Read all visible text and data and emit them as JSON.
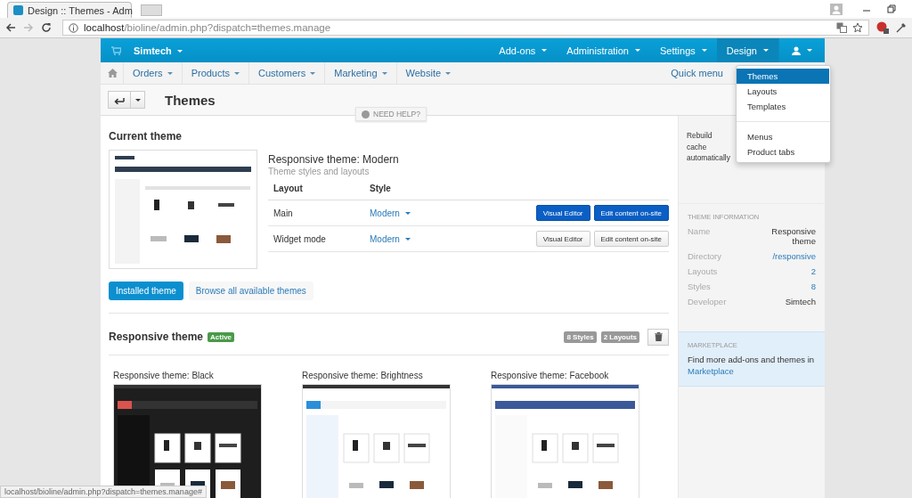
{
  "browser": {
    "tab_title": "Design :: Themes - Adm",
    "url_host": "localhost",
    "url_path": "/bioline/admin.php?dispatch=themes.manage",
    "status_url": "localhost/bioline/admin.php?dispatch=themes.manage#"
  },
  "topbar": {
    "brand": "Simtech",
    "menus": [
      {
        "label": "Add-ons",
        "selected": false
      },
      {
        "label": "Administration",
        "selected": false
      },
      {
        "label": "Settings",
        "selected": false
      },
      {
        "label": "Design",
        "selected": true
      }
    ]
  },
  "subnav": {
    "items": [
      "Orders",
      "Products",
      "Customers",
      "Marketing",
      "Website"
    ],
    "quick_menu": "Quick menu"
  },
  "dropdown": {
    "groups": [
      [
        {
          "label": "Themes",
          "selected": true
        },
        {
          "label": "Layouts",
          "selected": false
        },
        {
          "label": "Templates",
          "selected": false
        }
      ],
      [
        {
          "label": "Menus",
          "selected": false
        },
        {
          "label": "Product tabs",
          "selected": false
        }
      ]
    ]
  },
  "page": {
    "title": "Themes",
    "need_help": "NEED HELP?"
  },
  "current_theme": {
    "heading": "Current theme",
    "name": "Responsive theme: Modern",
    "subtitle": "Theme styles and layouts",
    "columns": [
      "Layout",
      "Style"
    ],
    "rows": [
      {
        "layout": "Main",
        "style": "Modern",
        "primary": true,
        "buttons": [
          "Visual Editor",
          "Edit content on-site"
        ]
      },
      {
        "layout": "Widget mode",
        "style": "Modern",
        "primary": false,
        "buttons": [
          "Visual Editor",
          "Edit content on-site"
        ]
      }
    ],
    "tabs": [
      {
        "label": "Installed theme",
        "selected": true
      },
      {
        "label": "Browse all available themes",
        "selected": false
      }
    ]
  },
  "theme_section": {
    "title": "Responsive theme",
    "badge": "Active",
    "counts": [
      "8 Styles",
      "2 Layouts"
    ],
    "styles": [
      {
        "name": "Responsive theme: Black",
        "kind": "picture"
      },
      {
        "name": "Responsive theme: Brightness",
        "kind": "picture"
      },
      {
        "name": "Responsive theme: Facebook",
        "kind": "picture"
      }
    ]
  },
  "sidebar": {
    "rebuild": "Rebuild cache automatically",
    "info_heading": "THEME INFORMATION",
    "info": [
      {
        "label": "Name",
        "value": "Responsive theme",
        "link": false
      },
      {
        "label": "Directory",
        "value": "/responsive",
        "link": true
      },
      {
        "label": "Layouts",
        "value": "2",
        "link": true
      },
      {
        "label": "Styles",
        "value": "8",
        "link": true
      },
      {
        "label": "Developer",
        "value": "Simtech",
        "link": false
      }
    ],
    "marketplace_heading": "MARKETPLACE",
    "marketplace_text": "Find more add-ons and themes in",
    "marketplace_link": "Marketplace"
  }
}
